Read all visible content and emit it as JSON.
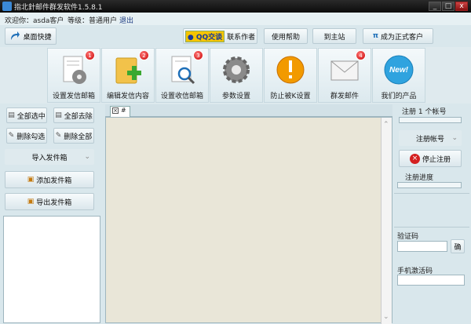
{
  "window": {
    "title": "指北針邮件群发软件1.5.8.1",
    "controls": [
      "_",
      "□",
      "x"
    ]
  },
  "infobar": {
    "welcome": "欢迎你：asda客户",
    "level": "等级：普通用户",
    "logout": "退出"
  },
  "topbar": {
    "desktop_shortcut": "桌面快捷",
    "qq_badge": "QQ交谈",
    "contact_author": "联系作者",
    "help": "使用帮助",
    "home": "到主站",
    "upgrade": "成为正式客户"
  },
  "ribbon": [
    {
      "label": "设置发信邮箱",
      "badge": "1",
      "icon": "gear-document-icon"
    },
    {
      "label": "编辑发信内容",
      "badge": "2",
      "icon": "edit-document-icon"
    },
    {
      "label": "设置收信邮箱",
      "badge": "3",
      "icon": "search-document-icon"
    },
    {
      "label": "参数设置",
      "icon": "gear-icon"
    },
    {
      "label": "防止被K设置",
      "icon": "warning-icon"
    },
    {
      "label": "群发邮件",
      "badge": "4",
      "icon": "mail-icon"
    },
    {
      "label": "我们的产品",
      "icon": "new-badge-icon"
    }
  ],
  "leftpanel": {
    "select_all": "全部选中",
    "deselect_all": "全部去除",
    "delete_checked": "删除勾选",
    "delete_all": "删除全部",
    "import_outbox": "导入发件箱",
    "add_outbox": "添加发件箱",
    "export_outbox": "导出发件箱"
  },
  "tab": {
    "label": "#"
  },
  "rightpanel": {
    "register_count": "注册 1 个帐号",
    "register_account": "注册帐号",
    "stop_register": "停止注册",
    "register_progress": "注册进度",
    "captcha_label": "验证码",
    "captcha_confirm": "确",
    "sms_label": "手机激活码"
  },
  "colors": {
    "accent": "#1e6fb8",
    "background": "#d9e7ec",
    "stop": "#d42020"
  }
}
